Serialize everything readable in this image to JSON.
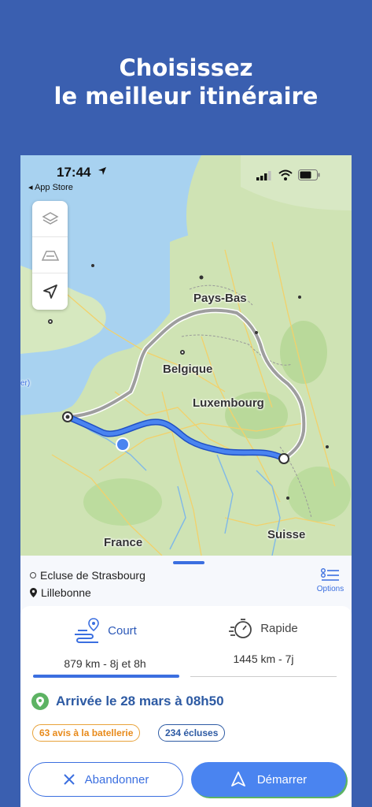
{
  "headline": {
    "line1": "Choisissez",
    "line2": "le meilleur itinéraire"
  },
  "status_bar": {
    "time": "17:44",
    "back_app": "◂ App Store"
  },
  "map": {
    "controls": [
      "layers-icon",
      "terrain-icon",
      "navigation-arrow-icon"
    ],
    "labels": {
      "pays_bas": "Pays-Bas",
      "belgique": "Belgique",
      "luxembourg": "Luxembourg",
      "france": "France",
      "suisse": "Suisse",
      "edge": "er)"
    },
    "colors": {
      "route_short": "#3b6fe0",
      "route_fast": "#9e9e9e"
    }
  },
  "route": {
    "from": "Ecluse de Strasbourg",
    "to": "Lillebonne",
    "options_label": "Options"
  },
  "modes": {
    "court": {
      "label": "Court",
      "detail": "879 km - 8j et 8h",
      "selected": true
    },
    "rapide": {
      "label": "Rapide",
      "detail": "1445 km - 7j",
      "selected": false
    }
  },
  "arrival": "Arrivée le 28 mars à 08h50",
  "chips": {
    "avis": "63 avis à la batellerie",
    "ecluses": "234 écluses"
  },
  "actions": {
    "abandon": "Abandonner",
    "start": "Démarrer"
  },
  "colors": {
    "background": "#3a5fb0",
    "accent": "#3b6fe0",
    "arrival_text": "#2d5aa3",
    "chip_orange": "#e88a1a",
    "pin_green": "#5db363"
  }
}
